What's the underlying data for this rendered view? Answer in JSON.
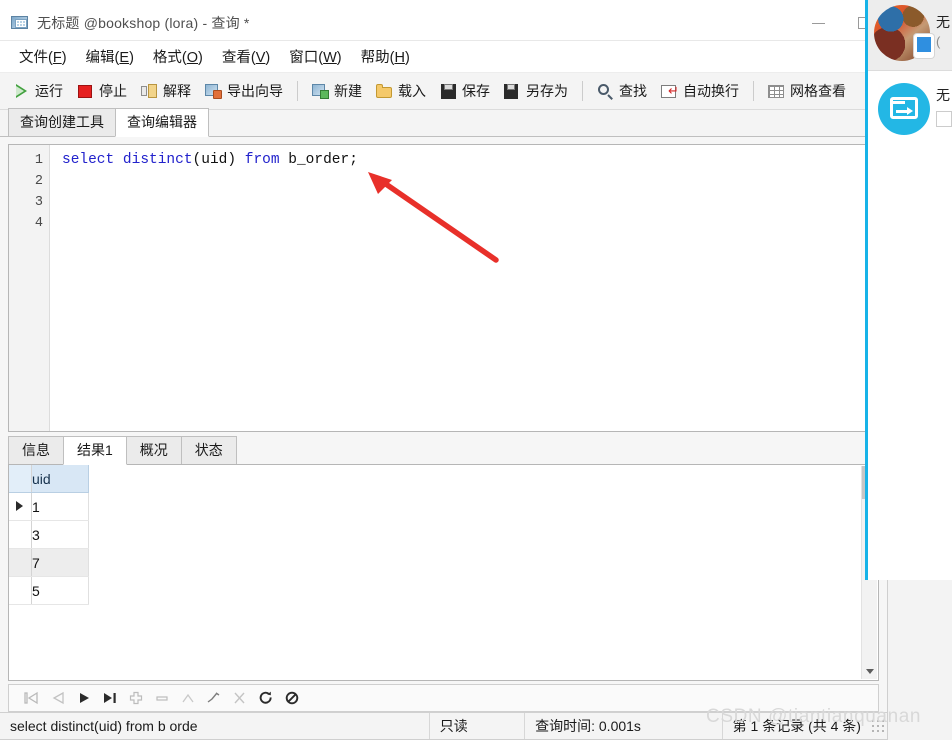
{
  "window": {
    "title": "无标题 @bookshop (lora) - 查询 *",
    "app_icon": "database-table-icon",
    "controls": {
      "minimize": "—",
      "maximize": "□"
    }
  },
  "menubar": {
    "items": [
      {
        "label": "文件",
        "accel": "F"
      },
      {
        "label": "编辑",
        "accel": "E"
      },
      {
        "label": "格式",
        "accel": "O"
      },
      {
        "label": "查看",
        "accel": "V"
      },
      {
        "label": "窗口",
        "accel": "W"
      },
      {
        "label": "帮助",
        "accel": "H"
      }
    ]
  },
  "toolbar": {
    "groups": [
      [
        {
          "label": "运行",
          "icon": "play-run-icon"
        },
        {
          "label": "停止",
          "icon": "stop-square-icon"
        },
        {
          "label": "解释",
          "icon": "explain-icon"
        },
        {
          "label": "导出向导",
          "icon": "export-wizard-icon"
        }
      ],
      [
        {
          "label": "新建",
          "icon": "new-query-icon"
        },
        {
          "label": "载入",
          "icon": "open-folder-icon"
        },
        {
          "label": "保存",
          "icon": "save-disk-icon"
        },
        {
          "label": "另存为",
          "icon": "save-as-disk-icon"
        }
      ],
      [
        {
          "label": "查找",
          "icon": "search-magnifier-icon"
        },
        {
          "label": "自动换行",
          "icon": "word-wrap-icon"
        }
      ],
      [
        {
          "label": "网格查看",
          "icon": "grid-view-icon"
        }
      ]
    ]
  },
  "editor_tabs": [
    {
      "label": "查询创建工具",
      "active": false
    },
    {
      "label": "查询编辑器",
      "active": true
    }
  ],
  "editor": {
    "line_numbers": [
      "1",
      "2",
      "3",
      "4"
    ],
    "tokens": [
      {
        "text": "select",
        "keyword": true
      },
      {
        "text": " ",
        "keyword": false
      },
      {
        "text": "distinct",
        "keyword": true
      },
      {
        "text": "(uid) ",
        "keyword": false
      },
      {
        "text": "from",
        "keyword": true
      },
      {
        "text": " b_order;",
        "keyword": false
      }
    ]
  },
  "annotation": {
    "type": "red-arrow",
    "color": "#e8302a"
  },
  "result_tabs": [
    {
      "label": "信息",
      "active": false
    },
    {
      "label": "结果1",
      "active": true
    },
    {
      "label": "概况",
      "active": false
    },
    {
      "label": "状态",
      "active": false
    }
  ],
  "result_grid": {
    "columns": [
      "uid"
    ],
    "rows": [
      {
        "values": [
          "1"
        ],
        "current": true
      },
      {
        "values": [
          "3"
        ],
        "current": false
      },
      {
        "values": [
          "7"
        ],
        "current": false
      },
      {
        "values": [
          "5"
        ],
        "current": false
      }
    ]
  },
  "nav_toolbar": {
    "buttons": [
      {
        "icon": "first-record-icon",
        "enabled": false
      },
      {
        "icon": "previous-record-icon",
        "enabled": false
      },
      {
        "icon": "next-record-icon",
        "enabled": true
      },
      {
        "icon": "last-record-icon",
        "enabled": true
      },
      {
        "icon": "add-record-icon",
        "enabled": false
      },
      {
        "icon": "delete-record-icon",
        "enabled": false
      },
      {
        "icon": "apply-change-icon",
        "enabled": false
      },
      {
        "icon": "edit-record-icon",
        "enabled": true
      },
      {
        "icon": "cancel-change-icon",
        "enabled": false
      },
      {
        "icon": "refresh-icon",
        "enabled": true
      },
      {
        "icon": "stop-load-icon",
        "enabled": true
      }
    ]
  },
  "statusbar": {
    "sql": "select distinct(uid) from b orde",
    "readonly": "只读",
    "query_time": "查询时间: 0.001s",
    "record_info": "第 1 条记录 (共 4 条)"
  },
  "overlay": {
    "accent": "#17b3e8",
    "contact": {
      "name": "无",
      "subtitle": "("
    },
    "items": [
      {
        "icon": "file-transfer-icon",
        "label": "无"
      }
    ]
  },
  "watermark": "CSDN @tiantianquanan"
}
